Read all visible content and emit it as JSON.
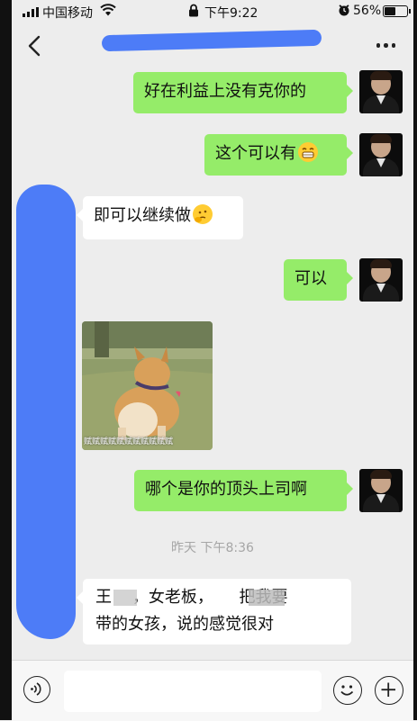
{
  "status_bar": {
    "carrier": "中国移动",
    "time": "下午9:22",
    "battery_percent": "56%",
    "battery_level": 0.56,
    "icons": [
      "signal-icon",
      "wifi-icon",
      "lock-icon",
      "alarm-icon",
      "battery-icon"
    ]
  },
  "header": {
    "title": "",
    "title_redacted": true,
    "icons": [
      "back-icon",
      "more-icon"
    ]
  },
  "messages": [
    {
      "from": "me",
      "text": "好在利益上没有克你的"
    },
    {
      "from": "me",
      "text": "这个可以有",
      "emoji": "grin-emoji"
    },
    {
      "from": "other",
      "text": "即可以继续做",
      "emoji": "thinking-emoji"
    },
    {
      "from": "me",
      "text": "可以"
    },
    {
      "from": "other",
      "type": "sticker",
      "sticker_caption": "赋赋赋赋赋赋赋赋赋赋赋"
    },
    {
      "from": "me",
      "text": "哪个是你的顶头上司啊"
    },
    {
      "from": "other",
      "text_line1": "王    ，女老板，     把我要",
      "text_line2": "带的女孩，说的感觉很对"
    }
  ],
  "timestamp": "昨天 下午8:36",
  "input_bar": {
    "placeholder": "",
    "icons": [
      "voice-icon",
      "emoji-icon",
      "plus-icon"
    ]
  },
  "colors": {
    "outgoing_bubble": "#95ec69",
    "incoming_bubble": "#ffffff",
    "background": "#ededed",
    "redaction": "#4d7cf7"
  }
}
